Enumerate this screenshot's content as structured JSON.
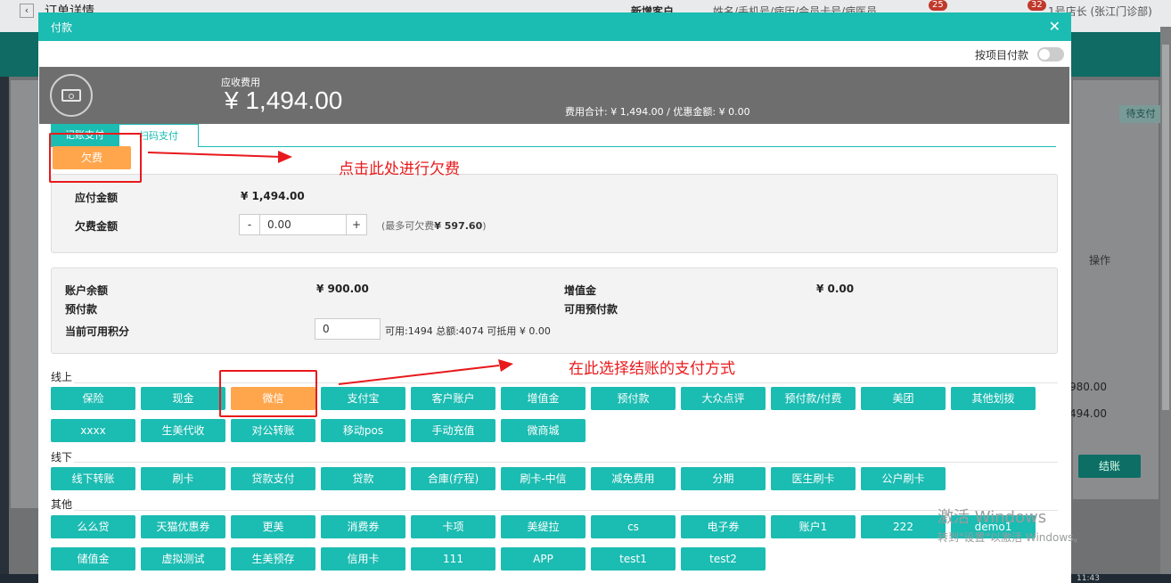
{
  "background": {
    "title": "订单详情",
    "new_customer": "新增客户",
    "search_placeholder": "姓名/手机号/病历/会员卡号/病医员",
    "badge1": "25",
    "badge2": "32",
    "user": "1号店长 (张江门诊部)",
    "op_header": "操作",
    "pending_pay": "待支付",
    "amount1": "980.00",
    "amount2": "494.00",
    "settle": "结账",
    "watermark1": "激活 Windows",
    "watermark2": "转到\"设置\"以激活 Windows。",
    "clock": "11:43"
  },
  "modal": {
    "title": "付款",
    "toggle_label": "按项目付款",
    "due_label": "应收费用",
    "due_value": "¥ 1,494.00",
    "fee_summary": "费用合计: ¥ 1,494.00 / 优惠金额: ¥ 0.00",
    "tabs": [
      "记账支付",
      "扫码支付"
    ],
    "debt_button": "欠费",
    "payable_label": "应付金额",
    "payable_value": "¥ 1,494.00",
    "debt_label": "欠费金额",
    "debt_value": "0.00",
    "minus": "-",
    "plus": "+",
    "debt_hint_prefix": "(最多可欠费",
    "debt_hint_max": "¥ 597.60",
    "debt_hint_suffix": ")",
    "balance_label": "账户余额",
    "balance_value": "¥ 900.00",
    "value_added_label": "增值金",
    "value_added_value": "¥ 0.00",
    "prepaid_label": "预付款",
    "avail_prepaid_label": "可用预付款",
    "points_label": "当前可用积分",
    "points_value": "0",
    "points_hint": "可用:1494 总额:4074 可抵用 ¥ 0.00",
    "online_label": "线上",
    "offline_label": "线下",
    "other_label": "其他",
    "online_methods": [
      "保险",
      "现金",
      "微信",
      "支付宝",
      "客户账户",
      "增值金",
      "预付款",
      "大众点评",
      "预付款/付费",
      "美团",
      "其他划拨",
      "xxxx",
      "生美代收",
      "对公转账",
      "移动pos",
      "手动充值",
      "微商城"
    ],
    "offline_methods": [
      "线下转账",
      "刷卡",
      "贷款支付",
      "贷款",
      "合庫(疗程)",
      "刷卡-中信",
      "减免费用",
      "分期",
      "医生刷卡",
      "公户刷卡"
    ],
    "other_methods": [
      "么么贷",
      "天猫优惠券",
      "更美",
      "消费券",
      "卡项",
      "美缇拉",
      "cs",
      "电子券",
      "账户1",
      "222",
      "demo1",
      "储值金",
      "虚拟测试",
      "生美预存",
      "信用卡",
      "111",
      "APP",
      "test1",
      "test2"
    ],
    "selected_method": "微信"
  },
  "annotations": {
    "debt_note": "点击此处进行欠费",
    "method_note": "在此选择结账的支付方式"
  },
  "colors": {
    "teal": "#1bbcb2",
    "orange": "#ffa64d",
    "annotation_red": "#e8191c"
  }
}
